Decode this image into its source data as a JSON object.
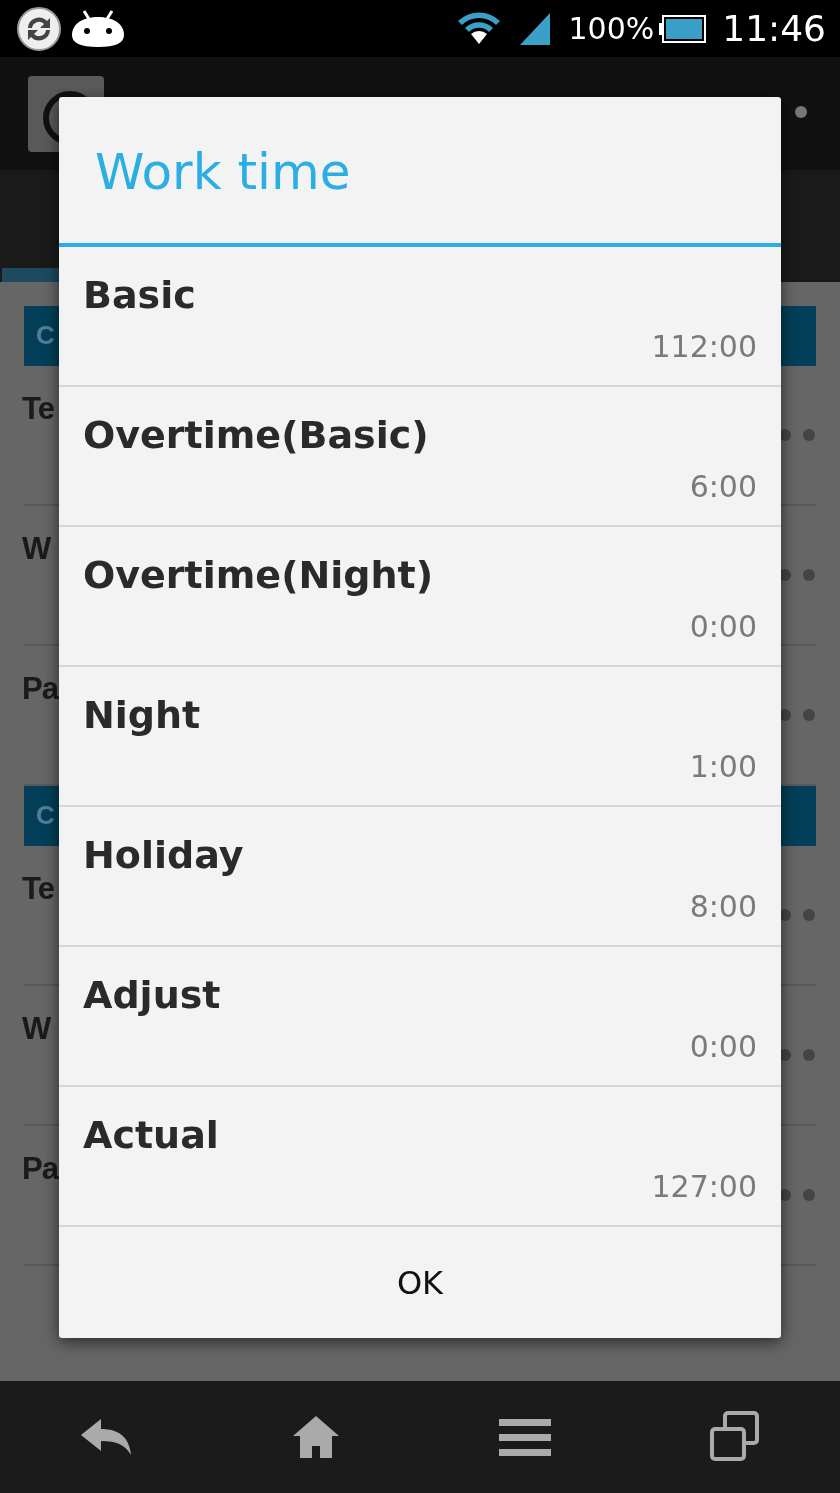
{
  "status_bar": {
    "battery": "100%",
    "time": "11:46"
  },
  "background": {
    "sections": [
      {
        "header": "C",
        "rows": [
          {
            "label": "Te"
          },
          {
            "label": "W"
          },
          {
            "label": "Pa"
          }
        ]
      },
      {
        "header": "C",
        "rows": [
          {
            "label": "Te"
          },
          {
            "label": "W"
          },
          {
            "label": "Pa"
          }
        ]
      }
    ]
  },
  "dialog": {
    "title": "Work time",
    "rows": [
      {
        "label": "Basic",
        "value": "112:00"
      },
      {
        "label": "Overtime(Basic)",
        "value": "6:00"
      },
      {
        "label": "Overtime(Night)",
        "value": "0:00"
      },
      {
        "label": "Night",
        "value": "1:00"
      },
      {
        "label": "Holiday",
        "value": "8:00"
      },
      {
        "label": "Adjust",
        "value": "0:00"
      },
      {
        "label": "Actual",
        "value": "127:00"
      }
    ],
    "button": "OK"
  }
}
